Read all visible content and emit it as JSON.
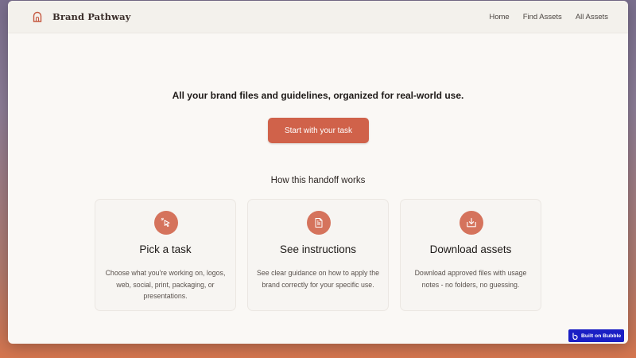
{
  "header": {
    "brand_name": "Brand Pathway",
    "brand_icon": "arch-logo-icon",
    "nav": [
      {
        "label": "Home"
      },
      {
        "label": "Find Assets"
      },
      {
        "label": "All Assets"
      }
    ]
  },
  "hero": {
    "tagline": "All your brand files and guidelines, organized for real-world use.",
    "cta_label": "Start with your task"
  },
  "handoff": {
    "title": "How this handoff works",
    "cards": [
      {
        "icon": "cursor-click-icon",
        "title": "Pick a task",
        "description": "Choose what you're working on, logos, web, social, print, packaging, or presentations."
      },
      {
        "icon": "document-icon",
        "title": "See instructions",
        "description": "See clear guidance on how to apply the brand correctly for your specific use."
      },
      {
        "icon": "download-icon",
        "title": "Download assets",
        "description": "Download approved files with usage notes - no folders, no guessing."
      }
    ]
  },
  "badge": {
    "label": "Built on Bubble"
  },
  "colors": {
    "accent": "#d0624a",
    "icon_circle": "#d5735c",
    "page_bg": "#faf8f5",
    "badge_bg": "#1a1fc4"
  }
}
